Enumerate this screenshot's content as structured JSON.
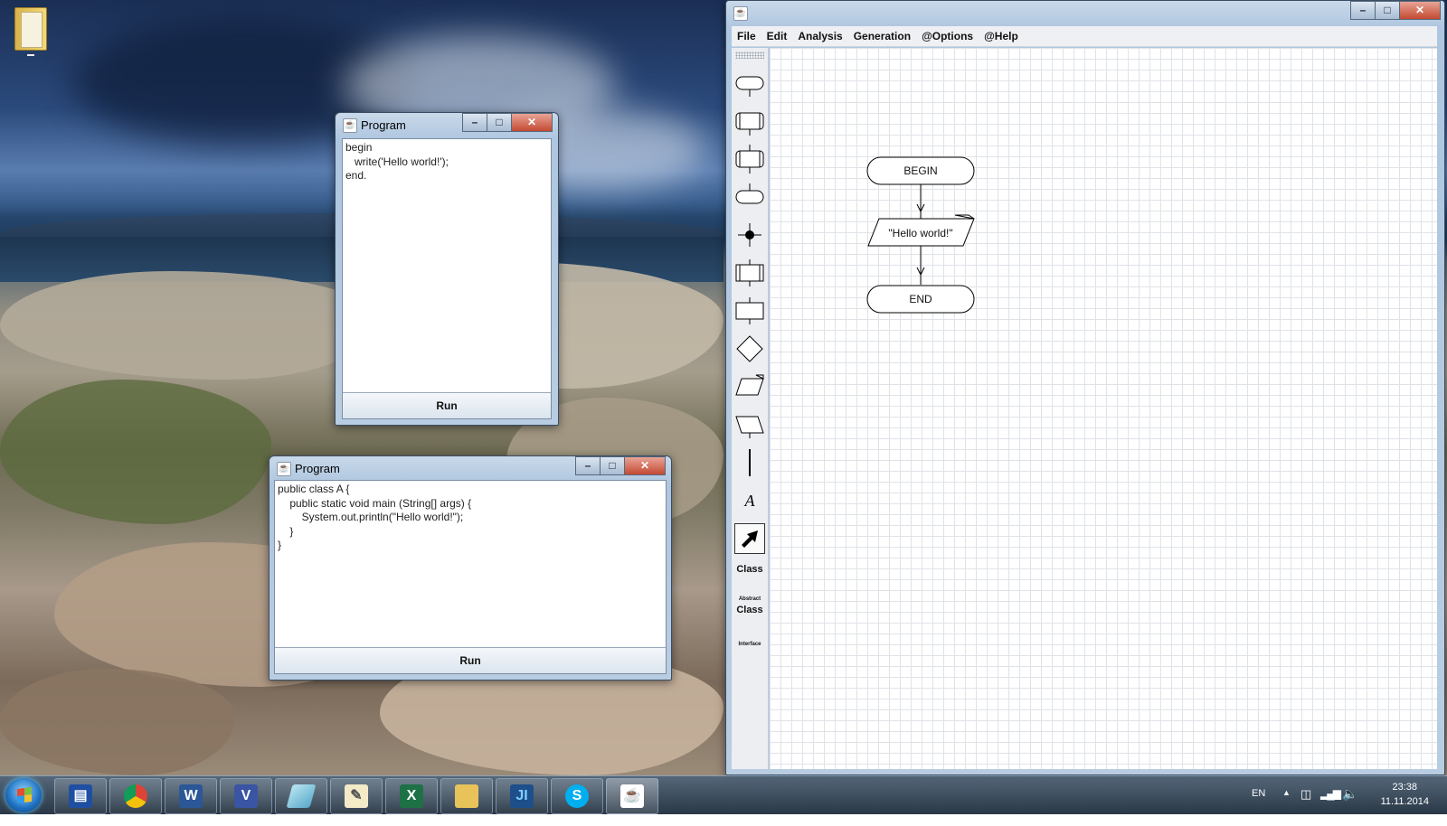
{
  "desktop": {
    "icons": [
      {
        "name": "folder-icon"
      }
    ]
  },
  "window_pascal": {
    "title": "Program",
    "code": "begin\n   write('Hello world!');\nend.",
    "run_label": "Run"
  },
  "window_java": {
    "title": "Program",
    "code": "public class A {\n    public static void main (String[] args) {\n        System.out.println(\"Hello world!\");\n    }\n}",
    "run_label": "Run"
  },
  "app": {
    "menu": [
      "File",
      "Edit",
      "Analysis",
      "Generation",
      "@Options",
      "@Help"
    ],
    "palette": {
      "class_label": "Class",
      "abstract_small": "Abstract",
      "abstract_label": "Class",
      "interface_label": "Interface",
      "text_tool_glyph": "A"
    },
    "flowchart": {
      "begin": "BEGIN",
      "output": "\"Hello world!\"",
      "end": "END"
    }
  },
  "taskbar": {
    "apps": [
      "save-icon",
      "chrome-icon",
      "word-icon",
      "visio-icon",
      "eraser-icon",
      "notepad-icon",
      "excel-icon",
      "explorer-icon",
      "intellij-icon",
      "skype-icon",
      "java-icon"
    ],
    "language": "EN",
    "time": "23:38",
    "date": "11.11.2014"
  }
}
